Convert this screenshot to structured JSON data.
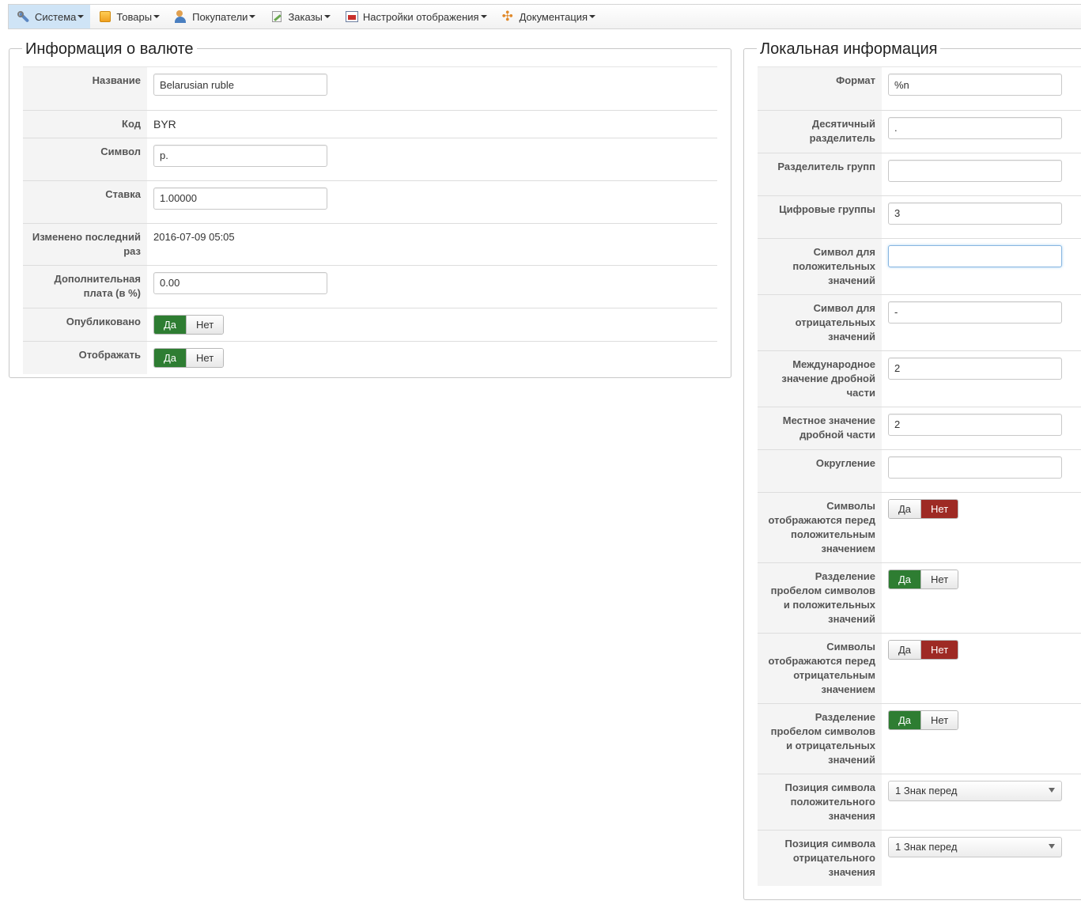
{
  "menu": [
    {
      "label": "Система",
      "icon": "tools-icon"
    },
    {
      "label": "Товары",
      "icon": "box-icon"
    },
    {
      "label": "Покупатели",
      "icon": "users-icon"
    },
    {
      "label": "Заказы",
      "icon": "orders-icon"
    },
    {
      "label": "Настройки отображения",
      "icon": "display-icon"
    },
    {
      "label": "Документация",
      "icon": "docs-icon"
    }
  ],
  "currency": {
    "title": "Информация о валюте",
    "name_label": "Название",
    "name_value": "Belarusian ruble",
    "code_label": "Код",
    "code_value": "BYR",
    "symbol_label": "Символ",
    "symbol_value": "р.",
    "rate_label": "Ставка",
    "rate_value": "1.00000",
    "modified_label": "Изменено последний раз",
    "modified_value": "2016-07-09 05:05",
    "fee_label": "Дополнительная плата (в %)",
    "fee_value": "0.00",
    "published_label": "Опубликовано",
    "display_label": "Отображать",
    "yes": "Да",
    "no": "Нет"
  },
  "locale": {
    "title": "Локальная информация",
    "format_label": "Формат",
    "format_value": "%n",
    "decimal_label": "Десятичный разделитель",
    "decimal_value": ".",
    "group_sep_label": "Разделитель групп",
    "group_sep_value": "",
    "digit_groups_label": "Цифровые группы",
    "digit_groups_value": "3",
    "pos_sign_label": "Символ для положительных значений",
    "pos_sign_value": "",
    "neg_sign_label": "Символ для отрицательных значений",
    "neg_sign_value": "-",
    "intl_frac_label": "Международное значение дробной части",
    "intl_frac_value": "2",
    "local_frac_label": "Местное значение дробной части",
    "local_frac_value": "2",
    "rounding_label": "Округление",
    "rounding_value": "",
    "pos_before_label": "Символы отображаются перед положительным значением",
    "pos_space_label": "Разделение пробелом символов и положительных значений",
    "neg_before_label": "Символы отображаются перед отрицательным значением",
    "neg_space_label": "Разделение пробелом символов и отрицательных значений",
    "pos_position_label": "Позиция символа положительного значения",
    "pos_position_value": "1 Знак перед",
    "neg_position_label": "Позиция символа отрицательного значения",
    "neg_position_value": "1 Знак перед",
    "yes": "Да",
    "no": "Нет"
  },
  "colors": {
    "yes_active": "#2e7d32",
    "no_active": "#9e2a24",
    "menu_active": "#cfe4f6"
  }
}
